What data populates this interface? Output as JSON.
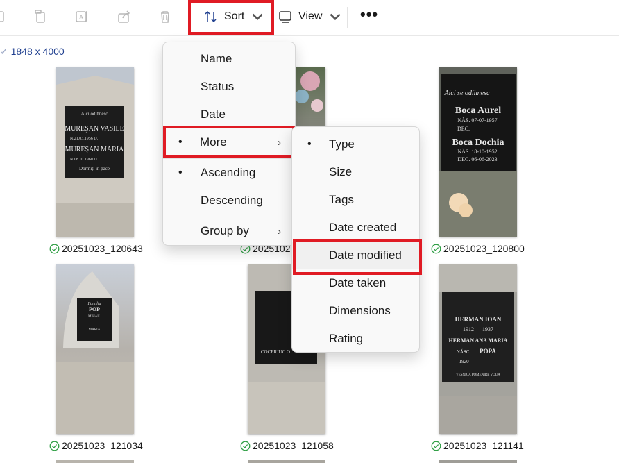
{
  "toolbar": {
    "sort_label": "Sort",
    "view_label": "View",
    "more_label": "•••",
    "icons": [
      "copy-icon",
      "rename-icon",
      "share-icon",
      "delete-icon",
      "sort-icon",
      "view-icon"
    ]
  },
  "breadcrumb": {
    "text": "1848 x 4000"
  },
  "sort_menu": {
    "items": [
      {
        "label": "Name"
      },
      {
        "label": "Status"
      },
      {
        "label": "Date"
      },
      {
        "label": "More",
        "bullet": "•",
        "arrow": "›"
      },
      {
        "label": "Ascending",
        "bullet": "•"
      },
      {
        "label": "Descending"
      },
      {
        "label": "Group by",
        "arrow": "›"
      }
    ]
  },
  "more_menu": {
    "items": [
      {
        "label": "Type",
        "bullet": "•"
      },
      {
        "label": "Size"
      },
      {
        "label": "Tags"
      },
      {
        "label": "Date created"
      },
      {
        "label": "Date modified"
      },
      {
        "label": "Date taken"
      },
      {
        "label": "Dimensions"
      },
      {
        "label": "Rating"
      }
    ]
  },
  "files": [
    {
      "name": "20251023_120643",
      "text": [
        "Aici odihnesc",
        "MUREŞAN VASILE",
        "N.21.03.1956 D.",
        "MUREŞAN MARIA",
        "N.08.10.1960 D.",
        "Dormiți în pace"
      ]
    },
    {
      "name": "20251023_120",
      "text": []
    },
    {
      "name": "20251023_120800",
      "text": [
        "Aici se odihnesc",
        "Boca Aurel",
        "NĂS. 07-07-1957",
        "DEC.",
        "Boca Dochia",
        "NĂS. 18-10-1952",
        "DEC. 06-06-2023"
      ]
    },
    {
      "name": "20251023_121034",
      "text": [
        "Familia",
        "POP",
        "MIHAIL",
        "MARIA"
      ]
    },
    {
      "name": "20251023_121058",
      "text": [
        "COCERIUC O"
      ]
    },
    {
      "name": "20251023_121141",
      "text": [
        "HERMAN IOAN",
        "1912 — 1937",
        "HERMAN ANA MARIA",
        "NĂSC.",
        "POPA",
        "1920 —",
        "VEȘNICA POMENIRE VOUA"
      ]
    }
  ],
  "colors": {
    "highlight": "#e01b24",
    "check": "#2f9e44",
    "accent_link": "#1f3f8f"
  }
}
